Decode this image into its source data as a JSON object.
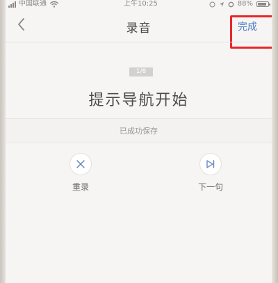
{
  "status_bar": {
    "carrier": "中国联通",
    "time": "上午10:25",
    "battery_percent": "88%",
    "battery_level": 0.88
  },
  "nav": {
    "title": "录音",
    "done_label": "完成"
  },
  "recording": {
    "progress": "1/8",
    "prompt": "提示导航开始",
    "save_status": "已成功保存"
  },
  "actions": {
    "rerecord_label": "重录",
    "next_label": "下一句"
  },
  "colors": {
    "accent": "#4a78c8",
    "highlight": "#e8262b"
  }
}
